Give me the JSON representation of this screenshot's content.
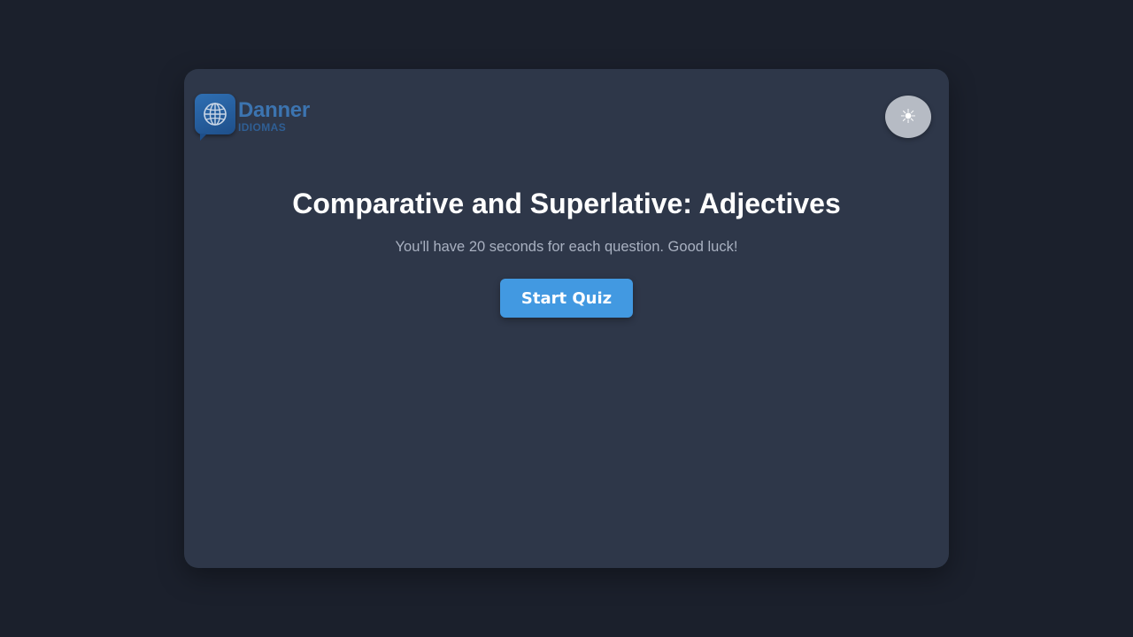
{
  "brand": {
    "name": "Danner",
    "subtitle": "IDIOMAS",
    "logo_icon": "globe-icon",
    "color": "#3c74b0"
  },
  "header": {
    "theme_toggle_icon": "sun-icon",
    "theme_toggle_glyph": "☀"
  },
  "quiz": {
    "title": "Comparative and Superlative: Adjectives",
    "instructions": "You'll have 20 seconds for each question. Good luck!",
    "start_label": "Start Quiz"
  },
  "colors": {
    "background": "#1b202c",
    "card": "#2e3749",
    "accent": "#4299e1"
  }
}
